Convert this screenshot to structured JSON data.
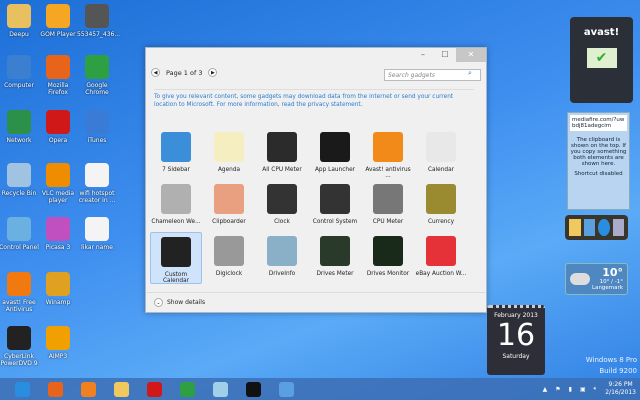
{
  "desktop_icons": [
    {
      "label": "Deepu",
      "color": "#e8c060"
    },
    {
      "label": "GOM Player",
      "color": "#f5a623"
    },
    {
      "label": "553457_436...",
      "color": "#555"
    },
    {
      "label": "Computer",
      "color": "#3b7fd0"
    },
    {
      "label": "Mozilla Firefox",
      "color": "#e8641b"
    },
    {
      "label": "Google Chrome",
      "color": "#2ea043"
    },
    {
      "label": "Network",
      "color": "#2c8f4a"
    },
    {
      "label": "Opera",
      "color": "#d01818"
    },
    {
      "label": "iTunes",
      "color": "#3a7bd5"
    },
    {
      "label": "Recycle Bin",
      "color": "#9fc3e0"
    },
    {
      "label": "VLC media player",
      "color": "#f08c00"
    },
    {
      "label": "wifi hotspot creator in ...",
      "color": "#f4f4f4"
    },
    {
      "label": "Control Panel",
      "color": "#6ab0e0"
    },
    {
      "label": "Picasa 3",
      "color": "#c050c0"
    },
    {
      "label": "likar name",
      "color": "#f4f4f4"
    },
    {
      "label": "avast! Free Antivirus",
      "color": "#f07a10"
    },
    {
      "label": "Winamp",
      "color": "#e0a020"
    },
    {
      "label": "CyberLink PowerDVD 9",
      "color": "#222"
    },
    {
      "label": "AIMP3",
      "color": "#f0a000"
    }
  ],
  "window": {
    "controls": {
      "minimize": "–",
      "maximize": "☐",
      "close": "✕"
    },
    "pager": {
      "label": "Page 1 of 3",
      "prev": "◀",
      "next": "▶"
    },
    "search_placeholder": "Search gadgets",
    "info_text": "To give you relevant content, some gadgets may download data from the internet or send your current location to Microsoft. For more information, read the privacy statement.",
    "gadgets": [
      {
        "label": "7 Sidebar",
        "color": "#3b8fd8"
      },
      {
        "label": "Agenda",
        "color": "#f5eec0"
      },
      {
        "label": "All CPU Meter",
        "color": "#2b2b2b"
      },
      {
        "label": "App Launcher",
        "color": "#1a1a1a"
      },
      {
        "label": "Avast! antivirus ...",
        "color": "#f28a1a"
      },
      {
        "label": "Calendar",
        "color": "#e8e8e8"
      },
      {
        "label": "Chameleon We...",
        "color": "#b0b0b0"
      },
      {
        "label": "Clipboarder",
        "color": "#e8a080"
      },
      {
        "label": "Clock",
        "color": "#333"
      },
      {
        "label": "Control System",
        "color": "#333"
      },
      {
        "label": "CPU Meter",
        "color": "#777"
      },
      {
        "label": "Currency",
        "color": "#9a8a30"
      },
      {
        "label": "Custom Calendar",
        "color": "#222"
      },
      {
        "label": "Digiclock",
        "color": "#999"
      },
      {
        "label": "DriveInfo",
        "color": "#8ab0c8"
      },
      {
        "label": "Drives Meter",
        "color": "#2a3a2a"
      },
      {
        "label": "Drives Monitor",
        "color": "#1a2a1a"
      },
      {
        "label": "eBay Auction W...",
        "color": "#e53238"
      }
    ],
    "selected_index": 12,
    "show_details": "Show details"
  },
  "side_gadgets": {
    "avast": {
      "logo": "avast!"
    },
    "clipboard": {
      "link": "mediafire.com/?uwbdj81adegcim",
      "note": "The clipboard is shown on the top. If you copy something both elements are shown here.",
      "shortcut": "Shortcut disabled"
    },
    "weather": {
      "temp": "10°",
      "range": "10° / -1°",
      "city": "Langemark"
    },
    "calendar": {
      "month": "February 2013",
      "day": "16",
      "weekday": "Saturday"
    }
  },
  "watermark": {
    "line1": "Windows 8 Pro",
    "line2": "Build 9200"
  },
  "taskbar": {
    "apps": [
      {
        "name": "ie",
        "color": "#2a8ee0"
      },
      {
        "name": "firefox",
        "color": "#e8641b"
      },
      {
        "name": "media",
        "color": "#f08020"
      },
      {
        "name": "explorer",
        "color": "#f0c860"
      },
      {
        "name": "opera",
        "color": "#d01818"
      },
      {
        "name": "chrome",
        "color": "#2ea043"
      },
      {
        "name": "notepad",
        "color": "#9fd0e8"
      },
      {
        "name": "cmd",
        "color": "#111"
      },
      {
        "name": "gadgets",
        "color": "#5aa0e0"
      }
    ],
    "time": "9:26 PM",
    "date": "2/16/2013"
  }
}
